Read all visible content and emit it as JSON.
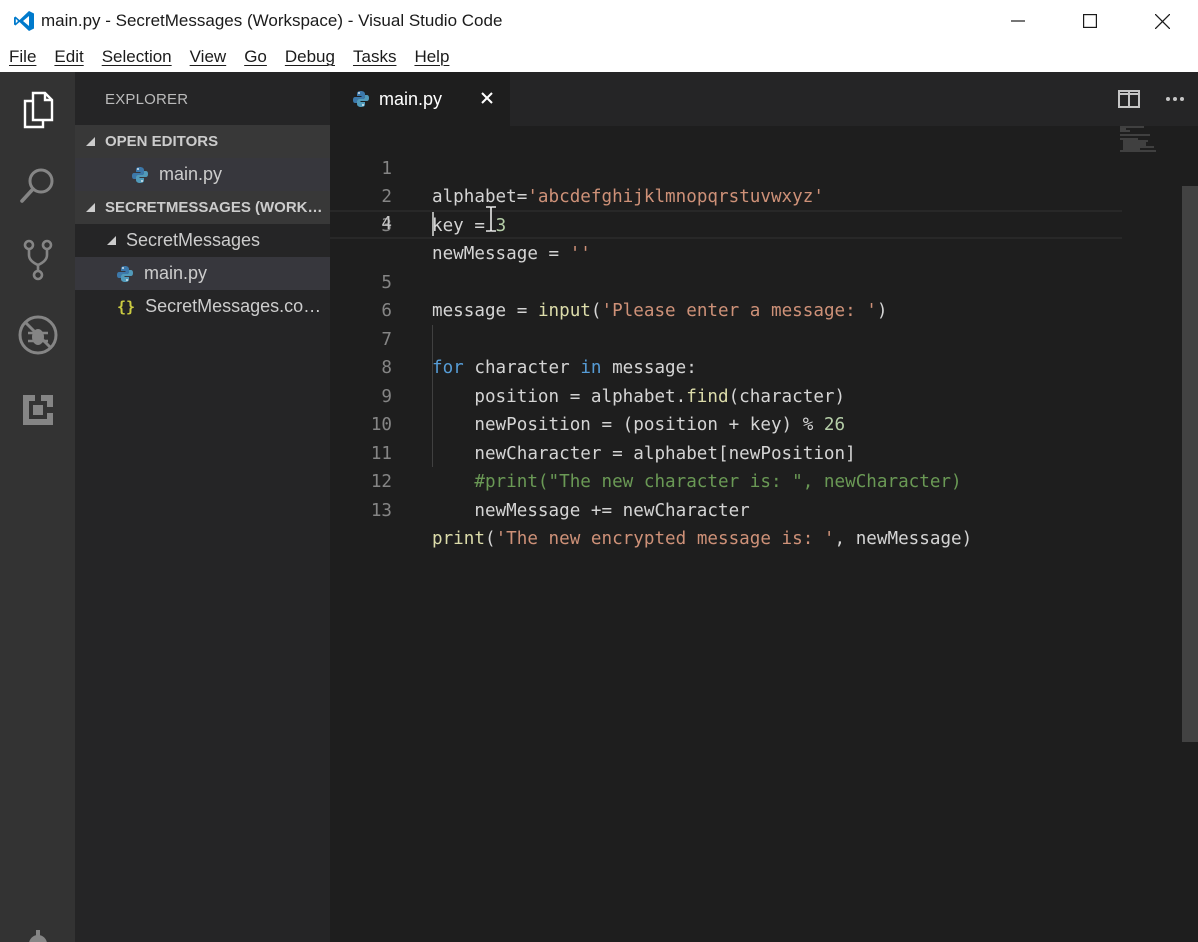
{
  "window": {
    "title": "main.py - SecretMessages (Workspace) - Visual Studio Code"
  },
  "menu": [
    {
      "label": "File"
    },
    {
      "label": "Edit"
    },
    {
      "label": "Selection"
    },
    {
      "label": "View"
    },
    {
      "label": "Go"
    },
    {
      "label": "Debug"
    },
    {
      "label": "Tasks"
    },
    {
      "label": "Help"
    }
  ],
  "activity_bar": [
    "explorer-icon",
    "search-icon",
    "source-control-icon",
    "debug-icon",
    "extensions-icon",
    "settings-gear-icon"
  ],
  "sidebar": {
    "title": "EXPLORER",
    "open_editors_label": "OPEN EDITORS",
    "open_editors": [
      {
        "label": "main.py"
      }
    ],
    "workspace_label": "SECRETMESSAGES (WORKSPACE)",
    "folder_label": "SecretMessages",
    "files": [
      {
        "label": "main.py",
        "icon": "python-file-icon"
      },
      {
        "label": "SecretMessages.code-workspace",
        "icon": "json-braces-icon"
      }
    ]
  },
  "editor": {
    "tab_label": "main.py",
    "current_line": 4,
    "line_numbers": [
      "1",
      "2",
      "3",
      "4",
      "5",
      "6",
      "7",
      "8",
      "9",
      "10",
      "11",
      "12",
      "13"
    ],
    "lines": [
      "alphabet='abcdefghijklmnopqrstuvwxyz'",
      "key = 3",
      "newMessage = ''",
      "",
      "message = input('Please enter a message: ')",
      "",
      "for character in message:",
      "    position = alphabet.find(character)",
      "    newPosition = (position + key) % 26",
      "    newCharacter = alphabet[newPosition]",
      "    #print(\"The new character is: \", newCharacter)",
      "    newMessage += newCharacter",
      "print('The new encrypted message is: ', newMessage)"
    ]
  },
  "colors": {
    "accent": "#007acc",
    "string": "#ce9178",
    "number": "#b5cea8",
    "keyword": "#569cd6",
    "comment": "#6a9955"
  }
}
